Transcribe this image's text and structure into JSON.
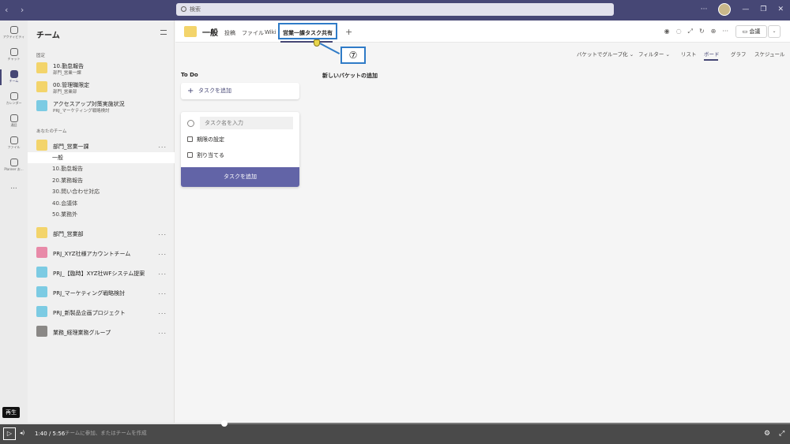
{
  "search": {
    "placeholder": "検索"
  },
  "rail": [
    {
      "label": "アクティビティ",
      "icon": "bell-icon"
    },
    {
      "label": "チャット",
      "icon": "chat-icon"
    },
    {
      "label": "チーム",
      "icon": "teams-icon",
      "active": true
    },
    {
      "label": "カレンダー",
      "icon": "calendar-icon"
    },
    {
      "label": "通話",
      "icon": "phone-icon"
    },
    {
      "label": "ファイル",
      "icon": "file-icon"
    },
    {
      "label": "Planner お...",
      "icon": "planner-icon"
    }
  ],
  "rail_more": "...",
  "teams_panel": {
    "title": "チーム",
    "pinned_section": "固定",
    "pinned": [
      {
        "name": "10.勤怠報告",
        "sub": "部門_営業一課"
      },
      {
        "name": "00.管理職限定",
        "sub": "部門_営業部"
      },
      {
        "name": "アクセスアップ対策実施状況",
        "sub": "PRJ_マーケティング戦略検討"
      }
    ],
    "your_teams_section": "あなたのチーム",
    "team1": "部門_営業一課",
    "channels": [
      "一般",
      "10.勤怠報告",
      "20.業務報告",
      "30.問い合わせ対応",
      "40.会議体",
      "50.業務外"
    ],
    "other_teams": [
      "部門_営業部",
      "PRJ_XYZ社様アカウントチーム",
      "PRJ_【臨時】XYZ社WFシステム提案",
      "PRJ_マーケティング戦略検討",
      "PRJ_新製品企画プロジェクト",
      "業務_経理業務グループ"
    ],
    "more": "..."
  },
  "header": {
    "title": "一般",
    "tabs": [
      "投稿",
      "ファイル",
      "Wiki",
      "営業一課タスク共有"
    ],
    "add_tab": "+",
    "meet_label": "会議"
  },
  "toolbar": [
    "バケットでグループ化",
    "フィルター",
    "リスト",
    "ボード",
    "グラフ",
    "スケジュール"
  ],
  "board": {
    "todo_title": "To Do",
    "new_bucket": "新しいバケットの追加",
    "add_task": "タスクを追加",
    "task_name_placeholder": "タスク名を入力",
    "due_date": "期限の設定",
    "assign": "割り当てる",
    "submit": "タスクを追加"
  },
  "annotation": {
    "number": "⑦"
  },
  "player": {
    "time": "1:40 / 5:56",
    "progress": 0.284,
    "tooltip": "再生",
    "overlay": "チームに参加、またはチームを作成"
  }
}
